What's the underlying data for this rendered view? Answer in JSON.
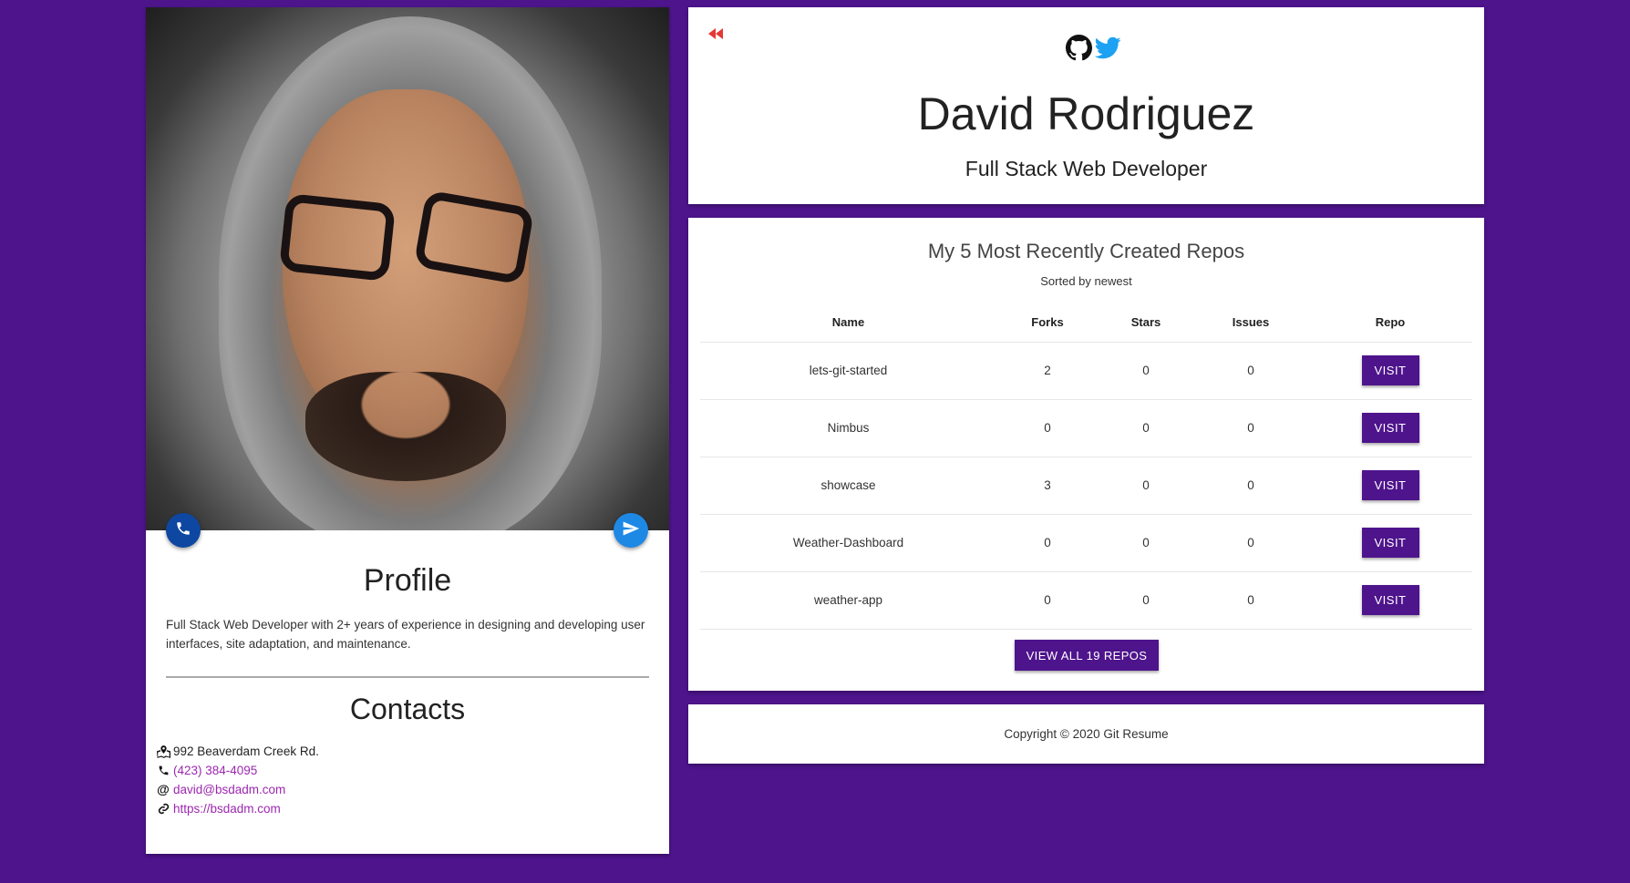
{
  "profile": {
    "photo_alt": "Profile photo",
    "heading": "Profile",
    "description": "Full Stack Web Developer with 2+ years of experience in designing and developing user interfaces, site adaptation, and maintenance.",
    "call_icon": "phone-icon",
    "send_icon": "send-icon"
  },
  "contacts": {
    "heading": "Contacts",
    "address": "992 Beaverdam Creek Rd.",
    "phone": "(423) 384-4095",
    "email": "david@bsdadm.com",
    "website": "https://bsdadm.com",
    "icons": [
      "map-marker-icon",
      "phone-icon",
      "at-icon",
      "link-icon"
    ]
  },
  "header": {
    "name": "David Rodriguez",
    "title": "Full Stack Web Developer",
    "back_icon": "rewind-icon",
    "social_icons": [
      "github-icon",
      "twitter-icon"
    ]
  },
  "repos": {
    "title": "My 5 Most Recently Created Repos",
    "subtitle": "Sorted by newest",
    "columns": [
      "Name",
      "Forks",
      "Stars",
      "Issues",
      "Repo"
    ],
    "rows": [
      {
        "name": "lets-git-started",
        "forks": "2",
        "stars": "0",
        "issues": "0",
        "action": "VISIT"
      },
      {
        "name": "Nimbus",
        "forks": "0",
        "stars": "0",
        "issues": "0",
        "action": "VISIT"
      },
      {
        "name": "showcase",
        "forks": "3",
        "stars": "0",
        "issues": "0",
        "action": "VISIT"
      },
      {
        "name": "Weather-Dashboard",
        "forks": "0",
        "stars": "0",
        "issues": "0",
        "action": "VISIT"
      },
      {
        "name": "weather-app",
        "forks": "0",
        "stars": "0",
        "issues": "0",
        "action": "VISIT"
      }
    ],
    "view_all_label": "VIEW ALL 19 REPOS"
  },
  "footer": {
    "copyright": "Copyright © 2020 Git Resume"
  },
  "colors": {
    "background": "#4e148c",
    "button": "#4e148c",
    "link": "#9c27b0",
    "twitter": "#1da1f2",
    "rewind": "#e53935"
  }
}
